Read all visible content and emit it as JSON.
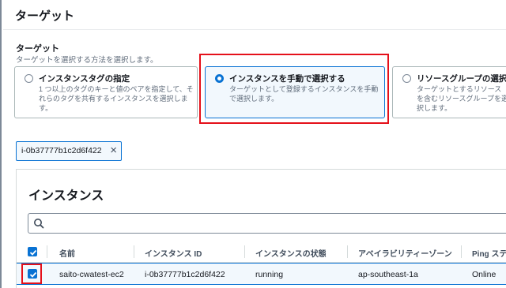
{
  "section": {
    "title": "ターゲット"
  },
  "field": {
    "label": "ターゲット",
    "description": "ターゲットを選択する方法を選択します。"
  },
  "tiles": [
    {
      "title": "インスタンスタグの指定",
      "description": "1 つ以上のタグのキーと値のペアを指定して、それらのタグを共有するインスタンスを選択します。",
      "selected": false
    },
    {
      "title": "インスタンスを手動で選択する",
      "description": "ターゲットとして登録するインスタンスを手動で選択します。",
      "selected": true
    },
    {
      "title": "リソースグループの選択",
      "description": "ターゲットとするリソースを含むリソースグループを選択します。",
      "selected": false
    }
  ],
  "token": {
    "label": "i-0b37777b1c2d6f422"
  },
  "instances": {
    "title": "インスタンス",
    "search_placeholder": "",
    "columns": [
      "名前",
      "インスタンス ID",
      "インスタンスの状態",
      "アベイラビリティーゾーン",
      "Ping ステー"
    ],
    "rows": [
      {
        "name": "saito-cwatest-ec2",
        "instance_id": "i-0b37777b1c2d6f422",
        "state": "running",
        "az": "ap-southeast-1a",
        "ping": "Online",
        "checked": true
      }
    ]
  },
  "colors": {
    "accent": "#0972d3",
    "highlight": "#e5101a"
  }
}
